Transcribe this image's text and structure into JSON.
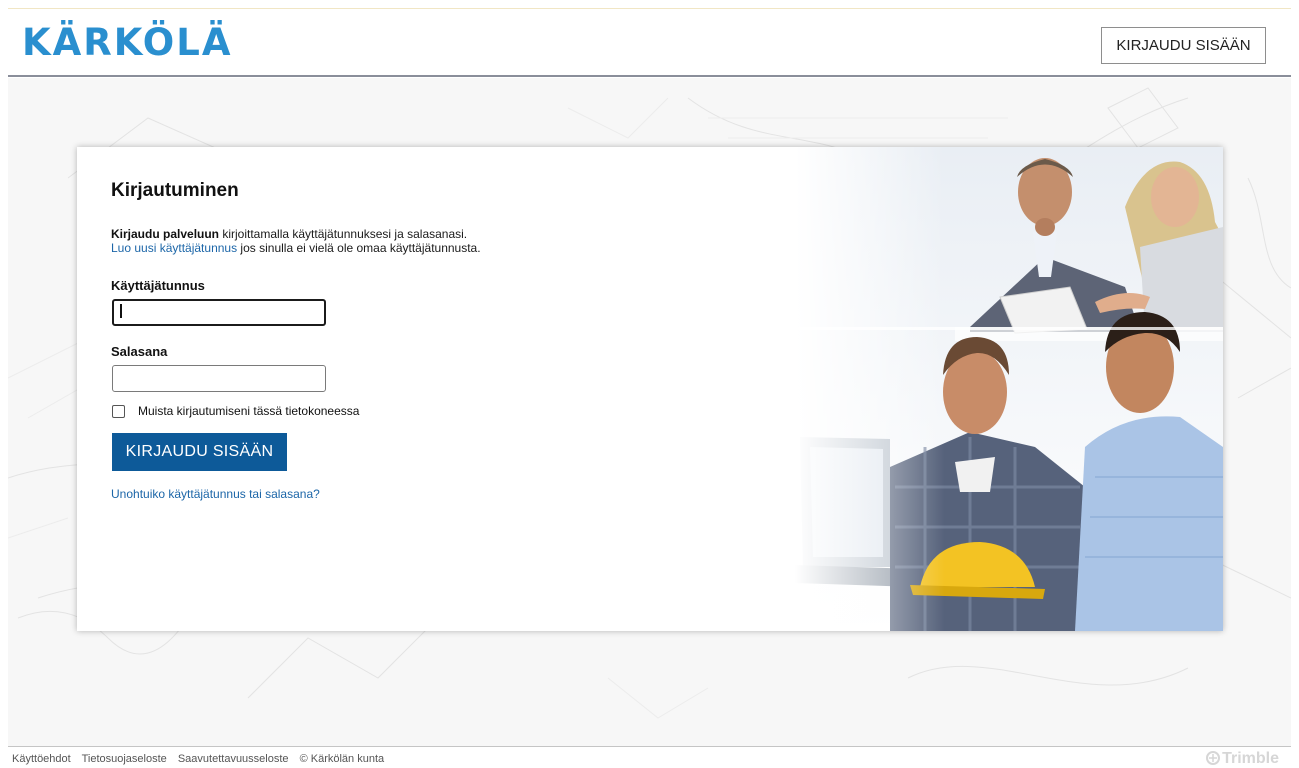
{
  "header": {
    "logo_text": "KÄRKÖLÄ",
    "login_button": "KIRJAUDU SISÄÄN"
  },
  "login": {
    "title": "Kirjautuminen",
    "intro_bold": "Kirjaudu palveluun",
    "intro_rest": " kirjoittamalla käyttäjätunnuksesi ja salasanasi.",
    "register_link": "Luo uusi käyttäjätunnus",
    "register_rest": " jos sinulla ei vielä ole omaa käyttäjätunnusta.",
    "username_label": "Käyttäjätunnus",
    "username_value": "",
    "password_label": "Salasana",
    "password_value": "",
    "remember_label": "Muista kirjautumiseni tässä tietokoneessa",
    "remember_checked": false,
    "submit_label": "KIRJAUDU SISÄÄN",
    "forgot_link": "Unohtuiko käyttäjätunnus tai salasana?"
  },
  "footer": {
    "links": [
      "Käyttöehdot",
      "Tietosuojaseloste",
      "Saavutettavuusseloste"
    ],
    "copyright": "© Kärkölän kunta",
    "brand": "Trimble"
  },
  "colors": {
    "logo": "#2a8fcf",
    "link": "#1c66a8",
    "primary_button": "#0d5a99",
    "header_border": "#8a8e9a"
  },
  "icons": {
    "footer_brand": "trimble-logo-icon",
    "hero": "office-team-photo"
  }
}
